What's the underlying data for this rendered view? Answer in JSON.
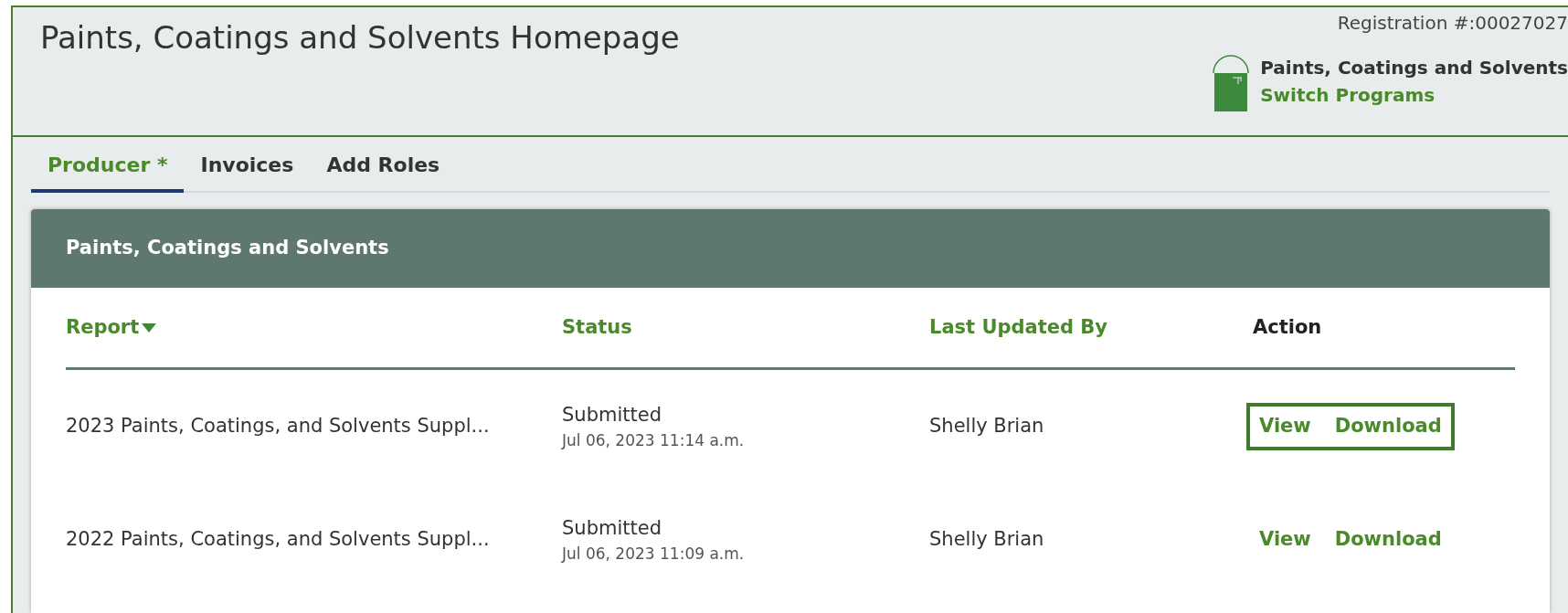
{
  "header": {
    "title": "Paints, Coatings and Solvents Homepage",
    "registration": "Registration #:00027027",
    "program": {
      "name": "Paints, Coatings and Solvents",
      "switch_link": "Switch Programs"
    }
  },
  "tabs": [
    {
      "label": "Producer *",
      "selected": true
    },
    {
      "label": "Invoices",
      "selected": false
    },
    {
      "label": "Add Roles",
      "selected": false
    }
  ],
  "card": {
    "title": "Paints, Coatings and Solvents",
    "table": {
      "columns": [
        {
          "label": "Report",
          "sortable": true
        },
        {
          "label": "Status",
          "sortable": false
        },
        {
          "label": "Last Updated By",
          "sortable": false
        },
        {
          "label": "Action",
          "sortable": false
        }
      ],
      "rows": [
        {
          "report": "2023 Paints, Coatings, and Solvents Suppl...",
          "status": "Submitted",
          "date": "Jul 06, 2023 11:14 a.m.",
          "updated_by": "Shelly Brian",
          "actions": [
            "View",
            "Download"
          ],
          "highlighted": true
        },
        {
          "report": "2022 Paints, Coatings, and Solvents Suppl...",
          "status": "Submitted",
          "date": "Jul 06, 2023 11:09 a.m.",
          "updated_by": "Shelly Brian",
          "actions": [
            "View",
            "Download"
          ],
          "highlighted": false
        }
      ]
    }
  }
}
